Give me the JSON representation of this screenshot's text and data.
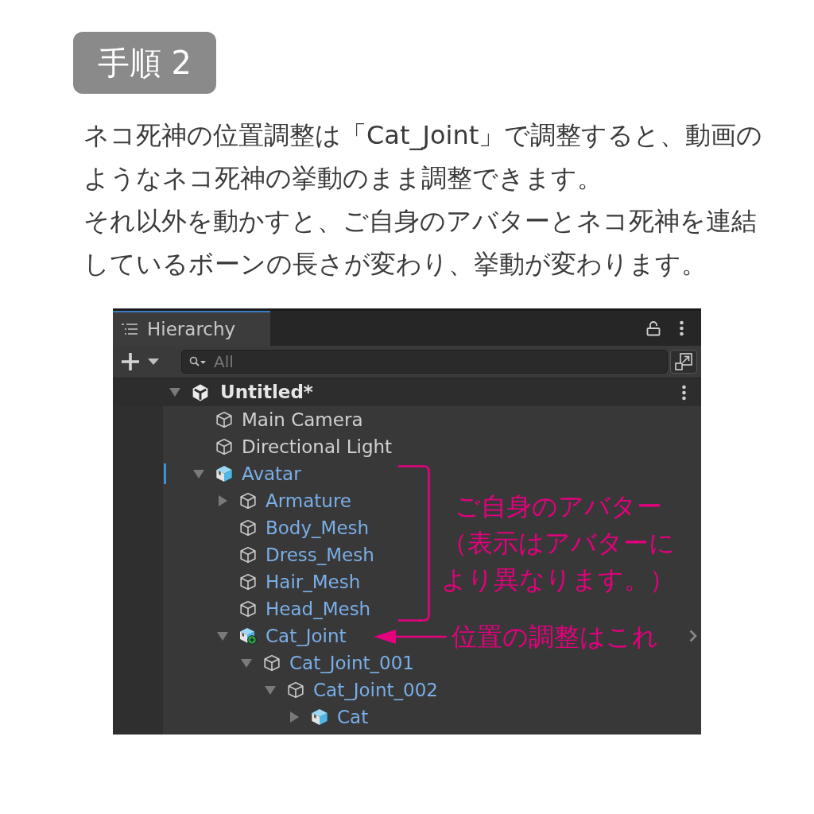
{
  "step_badge": "手順 2",
  "instructions": [
    "ネコ死神の位置調整は「Cat_Joint」で調整すると、動画のようなネコ死神の挙動のまま調整できます。",
    "それ以外を動かすと、ご自身のアバターとネコ死神を連結しているボーンの長さが変わり、挙動が変わります。"
  ],
  "hierarchy": {
    "tab": {
      "label": "Hierarchy",
      "selected": true
    },
    "search": {
      "placeholder": "All"
    },
    "scene": {
      "name": "Untitled*",
      "expanded": true,
      "children": [
        {
          "name": "Main Camera",
          "kind": "object",
          "modified": false,
          "hovered": false
        },
        {
          "name": "Directional Light",
          "kind": "object",
          "modified": false,
          "hovered": false
        },
        {
          "name": "Avatar",
          "kind": "prefab",
          "expanded": true,
          "modified": true,
          "hovered": false,
          "children": [
            {
              "name": "Armature",
              "kind": "prefab_part",
              "expanded": false,
              "modified": false,
              "hovered": false
            },
            {
              "name": "Body_Mesh",
              "kind": "prefab_part",
              "modified": false,
              "hovered": false
            },
            {
              "name": "Dress_Mesh",
              "kind": "prefab_part",
              "modified": false,
              "hovered": false
            },
            {
              "name": "Hair_Mesh",
              "kind": "prefab_part",
              "modified": false,
              "hovered": false
            },
            {
              "name": "Head_Mesh",
              "kind": "prefab_part",
              "modified": false,
              "hovered": false
            },
            {
              "name": "Cat_Joint",
              "kind": "added_prefab",
              "expanded": true,
              "modified": false,
              "hovered": true,
              "children": [
                {
                  "name": "Cat_Joint_001",
                  "kind": "prefab_part",
                  "expanded": true,
                  "modified": false,
                  "hovered": false,
                  "children": [
                    {
                      "name": "Cat_Joint_002",
                      "kind": "prefab_part",
                      "expanded": true,
                      "modified": false,
                      "hovered": false,
                      "children": [
                        {
                          "name": "Cat",
                          "kind": "prefab",
                          "expanded": false,
                          "modified": false,
                          "hovered": false
                        }
                      ]
                    }
                  ]
                }
              ]
            }
          ]
        }
      ]
    }
  },
  "annotations": [
    {
      "kind": "bracket",
      "text": "ご自身のアバター（表示はアバターにより異なります。）"
    },
    {
      "kind": "arrow",
      "text": "位置の調整はこれ"
    }
  ]
}
